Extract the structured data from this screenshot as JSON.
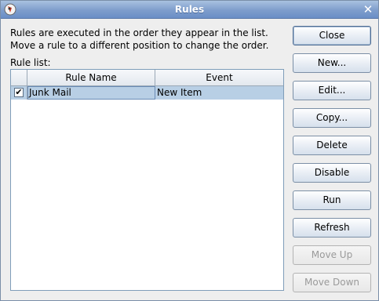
{
  "window": {
    "title": "Rules"
  },
  "description": {
    "line1": "Rules are executed in the order they appear in the list.",
    "line2": "Move a rule to a different position to change the order."
  },
  "rule_list": {
    "label": "Rule list:",
    "columns": [
      "",
      "Rule Name",
      "Event"
    ],
    "rows": [
      {
        "checked": true,
        "check_glyph": "✔",
        "name": "Junk Mail",
        "event": "New Item"
      }
    ]
  },
  "buttons": {
    "close": "Close",
    "new": "New...",
    "edit": "Edit...",
    "copy": "Copy...",
    "delete": "Delete",
    "disable": "Disable",
    "run": "Run",
    "refresh": "Refresh",
    "move_up": "Move Up",
    "move_down": "Move Down"
  },
  "colors": {
    "titlebar": "#7e9dcc",
    "selection": "#b8cfe5"
  }
}
